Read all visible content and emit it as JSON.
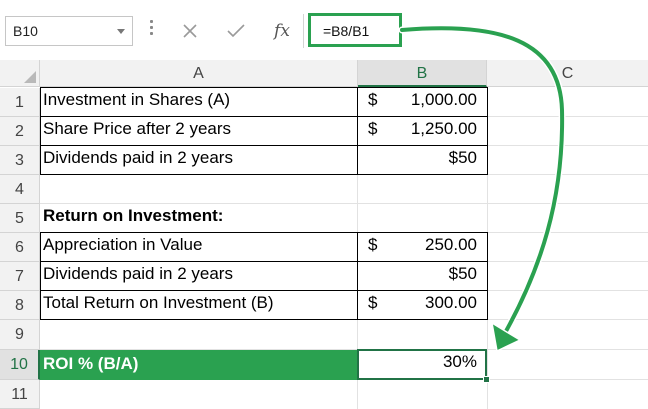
{
  "formula_bar": {
    "name_box": "B10",
    "cancel_icon": "close-icon",
    "enter_icon": "check-icon",
    "function_label": "fx",
    "formula": "=B8/B1"
  },
  "columns": [
    "A",
    "B",
    "C"
  ],
  "selected_column": "B",
  "rows": [
    {
      "num": "1",
      "label": "Investment in Shares (A)",
      "dollar": "$",
      "value": "1,000.00"
    },
    {
      "num": "2",
      "label": "Share Price after 2 years",
      "dollar": "$",
      "value": "1,250.00"
    },
    {
      "num": "3",
      "label": "Dividends paid in 2 years",
      "dollar": "",
      "value": "$50"
    },
    {
      "num": "4",
      "label": "",
      "dollar": "",
      "value": ""
    },
    {
      "num": "5",
      "label": "Return on Investment:",
      "dollar": "",
      "value": ""
    },
    {
      "num": "6",
      "label": "Appreciation in Value",
      "dollar": "$",
      "value": "250.00"
    },
    {
      "num": "7",
      "label": "Dividends paid in 2 years",
      "dollar": "",
      "value": "$50"
    },
    {
      "num": "8",
      "label": "Total Return on Investment (B)",
      "dollar": "$",
      "value": "300.00"
    },
    {
      "num": "9",
      "label": "",
      "dollar": "",
      "value": ""
    },
    {
      "num": "10",
      "label": "ROI % (B/A)",
      "dollar": "",
      "value": "30%"
    },
    {
      "num": "11",
      "label": "",
      "dollar": "",
      "value": ""
    }
  ],
  "colors": {
    "highlight_green": "#2aa150",
    "excel_green": "#217346"
  }
}
